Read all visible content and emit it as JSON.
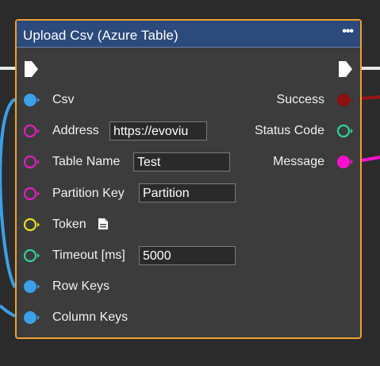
{
  "node": {
    "title": "Upload Csv (Azure Table)",
    "menu_icon": "more-dots-icon",
    "border_color": "#f0a030",
    "header_color": "#2c4a7c"
  },
  "inputs": [
    {
      "label": "Csv",
      "pin": "filled",
      "color": "#3aa0e8"
    },
    {
      "label": "Address",
      "pin": "hollow",
      "color": "#e020c0",
      "value": "https://evoviu"
    },
    {
      "label": "Table Name",
      "pin": "hollow",
      "color": "#e020c0",
      "value": "Test"
    },
    {
      "label": "Partition Key",
      "pin": "hollow",
      "color": "#e020c0",
      "value": "Partition"
    },
    {
      "label": "Token",
      "pin": "hollow",
      "color": "#e8e020",
      "icon": "document-icon"
    },
    {
      "label": "Timeout [ms]",
      "pin": "hollow",
      "color": "#30d0a0",
      "value": "5000"
    },
    {
      "label": "Row Keys",
      "pin": "filled",
      "color": "#3aa0e8"
    },
    {
      "label": "Column Keys",
      "pin": "filled",
      "color": "#3aa0e8"
    }
  ],
  "outputs": [
    {
      "label": "Success",
      "pin": "filled",
      "color": "#8b1010"
    },
    {
      "label": "Status Code",
      "pin": "hollow",
      "color": "#30d0a0"
    },
    {
      "label": "Message",
      "pin": "filled",
      "color": "#ff10d0"
    }
  ]
}
